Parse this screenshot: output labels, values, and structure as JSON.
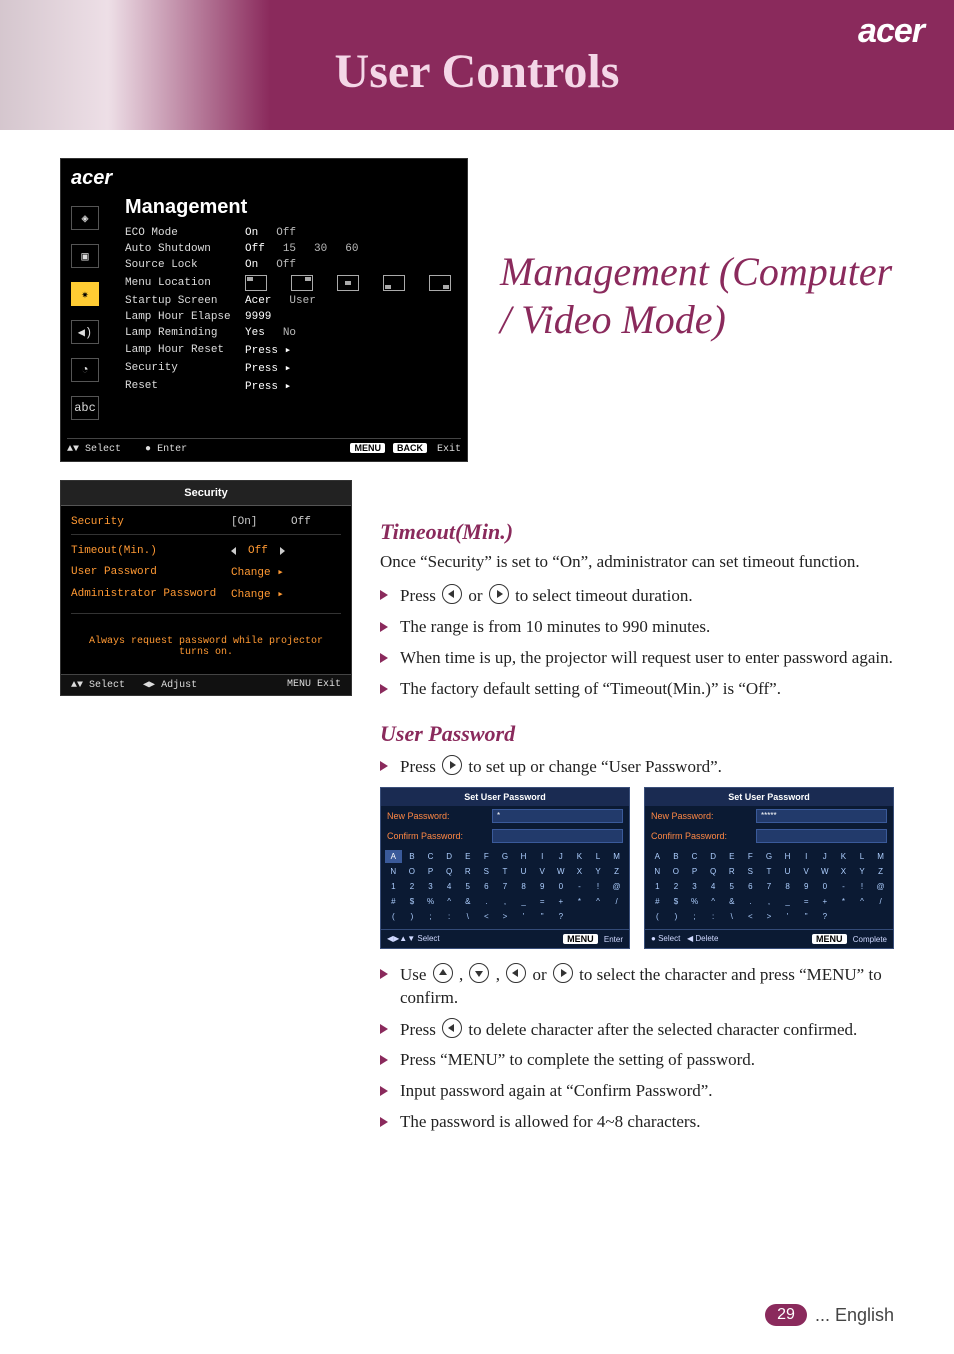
{
  "header": {
    "title": "User Controls",
    "logo_text": "acer"
  },
  "osd_management": {
    "brand": "acer",
    "title": "Management",
    "rows": [
      {
        "label": "ECO Mode",
        "options": [
          "On",
          "Off"
        ]
      },
      {
        "label": "Auto Shutdown",
        "options": [
          "Off",
          "15",
          "30",
          "60"
        ]
      },
      {
        "label": "Source Lock",
        "options": [
          "On",
          "Off"
        ]
      },
      {
        "label": "Menu Location",
        "type": "loc"
      },
      {
        "label": "Startup Screen",
        "options": [
          "Acer",
          "User"
        ]
      },
      {
        "label": "Lamp Hour Elapse",
        "options": [
          "9999"
        ]
      },
      {
        "label": "Lamp Reminding",
        "options": [
          "Yes",
          "No"
        ]
      },
      {
        "label": "Lamp Hour Reset",
        "options": [
          "Press ▸"
        ]
      },
      {
        "label": "Security",
        "options": [
          "Press ▸"
        ]
      },
      {
        "label": "Reset",
        "options": [
          "Press ▸"
        ]
      }
    ],
    "footer": {
      "select": "Select",
      "enter": "Enter",
      "menu": "MENU",
      "back": "BACK",
      "exit": "Exit"
    }
  },
  "osd_security": {
    "title": "Security",
    "row_security": {
      "label": "Security",
      "selected": "[On]",
      "other": "Off"
    },
    "row_timeout": {
      "label": "Timeout(Min.)",
      "value": "Off"
    },
    "row_user_pw": {
      "label": "User Password",
      "value": "Change ▸"
    },
    "row_admin_pw": {
      "label": "Administrator Password",
      "value": "Change ▸"
    },
    "message": "Always request password while projector turns on.",
    "footer": {
      "select": "Select",
      "adjust": "Adjust",
      "menu": "MENU",
      "exit": "Exit"
    }
  },
  "section_title": "Management (Computer / Video Mode)",
  "timeout": {
    "heading": "Timeout(Min.)",
    "intro": "Once “Security” is set to “On”, administrator can set timeout function.",
    "b1_pre": "Press ",
    "b1_mid": " or ",
    "b1_post": " to select timeout duration.",
    "b2": "The range is from 10 minutes to 990 minutes.",
    "b3": "When time is up, the projector will request user to enter password again.",
    "b4": "The factory default setting of “Timeout(Min.)” is “Off”."
  },
  "user_password": {
    "heading": "User Password",
    "line_pre": "Press ",
    "line_post": " to set up or change “User Password”.",
    "kbd": {
      "title": "Set User Password",
      "new_label": "New Password:",
      "confirm_label": "Confirm Password:",
      "field1_a": "*",
      "field1_b": "*****",
      "rows": [
        [
          "A",
          "B",
          "C",
          "D",
          "E",
          "F",
          "G",
          "H",
          "I",
          "J",
          "K",
          "L",
          "M"
        ],
        [
          "N",
          "O",
          "P",
          "Q",
          "R",
          "S",
          "T",
          "U",
          "V",
          "W",
          "X",
          "Y",
          "Z"
        ],
        [
          "1",
          "2",
          "3",
          "4",
          "5",
          "6",
          "7",
          "8",
          "9",
          "0",
          "-",
          "!",
          "@"
        ],
        [
          "#",
          "$",
          "%",
          "^",
          "&",
          ".",
          ",",
          "_",
          "=",
          "+",
          "*",
          "^",
          "/"
        ],
        [
          "(",
          ")",
          ";",
          ":",
          "\\",
          "<",
          ">",
          "'",
          "\"",
          "?",
          " ",
          " ",
          " "
        ]
      ],
      "footer_a": {
        "select": "Select",
        "menu": "MENU",
        "enter": "Enter"
      },
      "footer_b": {
        "select": "Select",
        "delete": "Delete",
        "menu": "MENU",
        "complete": "Complete"
      }
    },
    "b1_pre": "Use ",
    "b1_sep": " , ",
    "b1_or": " or ",
    "b1_post": " to select the character and press “MENU” to confirm.",
    "b2_pre": "Press ",
    "b2_post": " to delete character after the selected character confirmed.",
    "b3": "Press “MENU” to complete the setting of password.",
    "b4": "Input password again at “Confirm Password”.",
    "b5": "The password is allowed for 4~8 characters."
  },
  "page_footer": {
    "page": "29",
    "lang": "... English"
  }
}
